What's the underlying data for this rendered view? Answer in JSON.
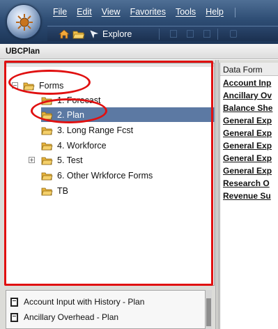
{
  "menu": [
    "File",
    "Edit",
    "View",
    "Favorites",
    "Tools",
    "Help"
  ],
  "toolbar": {
    "explore_label": "Explore",
    "icons": [
      "home-icon",
      "folder-icon",
      "explore-icon"
    ]
  },
  "app_title": "UBCPlan",
  "tree": {
    "root": {
      "label": "Forms",
      "expanded": true
    },
    "children": [
      {
        "label": "1. Forecast"
      },
      {
        "label": "2. Plan",
        "selected": true
      },
      {
        "label": "3. Long Range Fcst"
      },
      {
        "label": "4. Workforce"
      },
      {
        "label": "5. Test",
        "expandable": true
      },
      {
        "label": "6. Other Wrkforce Forms"
      },
      {
        "label": "TB"
      }
    ]
  },
  "right_panel": {
    "header": "Data Form",
    "items": [
      "Account Inp",
      "Ancillary Ov",
      "Balance She",
      "General Exp",
      "General Exp",
      "General Exp",
      "General Exp",
      "General Exp",
      "Research O",
      "Revenue Su"
    ]
  },
  "bottom_list": {
    "items": [
      "Account Input with History - Plan",
      "Ancillary Overhead - Plan"
    ]
  },
  "colors": {
    "selection": "#5c79a3",
    "highlight": "#e01010",
    "topband": "#2e4d74"
  }
}
